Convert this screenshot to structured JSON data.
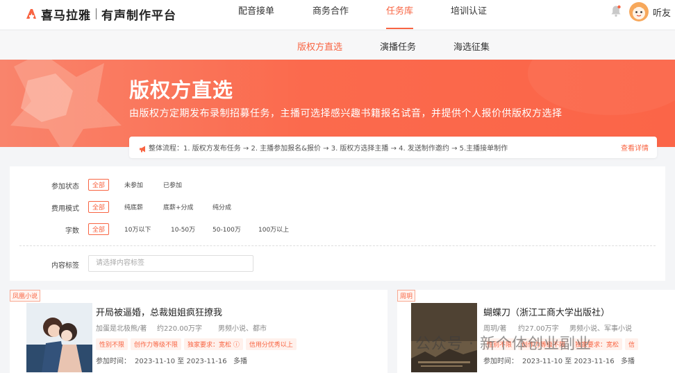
{
  "header": {
    "brand": "喜马拉雅",
    "subtitle": "有声制作平台",
    "nav": [
      "配音接单",
      "商务合作",
      "任务库",
      "培训认证"
    ],
    "active_nav": "任务库",
    "username": "听友",
    "accent": "#f86442"
  },
  "subnav": {
    "items": [
      "版权方直选",
      "演播任务",
      "海选征集"
    ],
    "active": "版权方直选"
  },
  "banner": {
    "title": "版权方直选",
    "description": "由版权方定期发布录制招募任务，主播可选择感兴趣书籍报名试音，并提供个人报价供版权方选择"
  },
  "flow": {
    "text": "整体流程：1. 版权方发布任务 → 2. 主播参加报名&报价 → 3. 版权方选择主播 → 4. 发送制作邀约 → 5.主播接单制作",
    "link": "查看详情"
  },
  "filters": {
    "status_label": "参加状态",
    "status_options": [
      "全部",
      "未参加",
      "已参加"
    ],
    "fee_label": "费用模式",
    "fee_options": [
      "全部",
      "纯底薪",
      "底薪+分成",
      "纯分成"
    ],
    "words_label": "字数",
    "words_options": [
      "全部",
      "10万以下",
      "10-50万",
      "50-100万",
      "100万以上"
    ],
    "tag_label": "内容标签",
    "tag_placeholder": "请选择内容标签"
  },
  "cards": [
    {
      "source": "凤凰小说",
      "title": "开局被逼婚，总裁姐姐疯狂撩我",
      "author": "加蛋是北极熊/著",
      "words": "约220.00万字",
      "category": "男频小说、都市",
      "tags": [
        "性别不限",
        "创作力等级不限",
        "独家要求：宽松 ⓘ",
        "信用分优秀以上"
      ],
      "time_label": "参加时间：",
      "time_range": "2023-11-10 至 2023-11-16",
      "mode": "多播"
    },
    {
      "source": "周玥",
      "title": "蝴蝶刀（浙江工商大学出版社）",
      "author": "周玥/著",
      "words": "约27.00万字",
      "category": "男频小说、军事小说",
      "tags": [
        "性别不限",
        "创作力等级不限",
        "独家要求：宽松",
        "信"
      ],
      "time_label": "参加时间：",
      "time_range": "2023-11-10 至 2023-11-16",
      "mode": "多播"
    }
  ],
  "watermark": "公众号 · 新个体创业副业"
}
